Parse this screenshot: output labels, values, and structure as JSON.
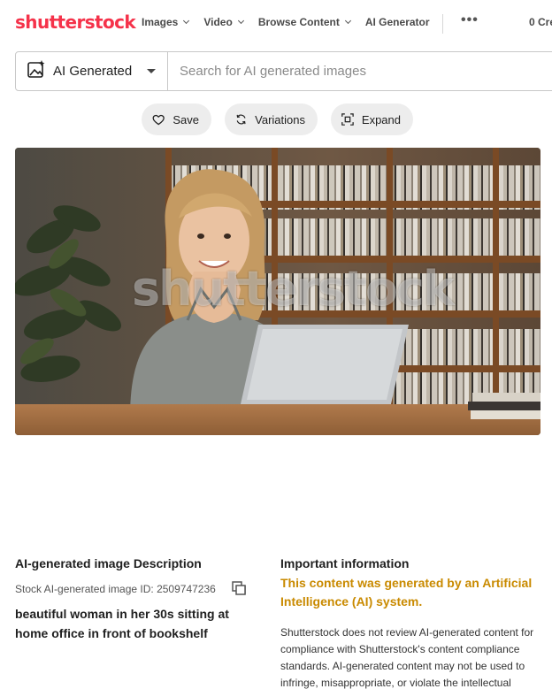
{
  "header": {
    "logo": "shutterstock",
    "nav": [
      {
        "label": "Images",
        "has_dropdown": true
      },
      {
        "label": "Video",
        "has_dropdown": true
      },
      {
        "label": "Browse Content",
        "has_dropdown": true
      },
      {
        "label": "AI Generator",
        "has_dropdown": false
      }
    ],
    "more_label": "•••",
    "credits_label": "0 Cre"
  },
  "search": {
    "type_label": "AI Generated",
    "placeholder": "Search for AI generated images",
    "value": ""
  },
  "actions": {
    "save_label": "Save",
    "variations_label": "Variations",
    "expand_label": "Expand"
  },
  "image": {
    "watermark": "shutterstock"
  },
  "description": {
    "heading": "AI-generated image Description",
    "stock_id": "Stock AI-generated image ID: 2509747236",
    "title": "beautiful woman in her 30s sitting at home office in front of bookshelf"
  },
  "important": {
    "heading": "Important information",
    "highlight": "This content was generated by an Artificial Intelligence (AI) system.",
    "body": "Shutterstock does not review AI-generated content for compliance with Shutterstock's content compliance standards. AI-generated content may not be used to infringe, misappropriate, or violate the intellectual"
  },
  "colors": {
    "brand": "#f5324a",
    "highlight": "#c98a00",
    "pill_bg": "#ededed"
  }
}
